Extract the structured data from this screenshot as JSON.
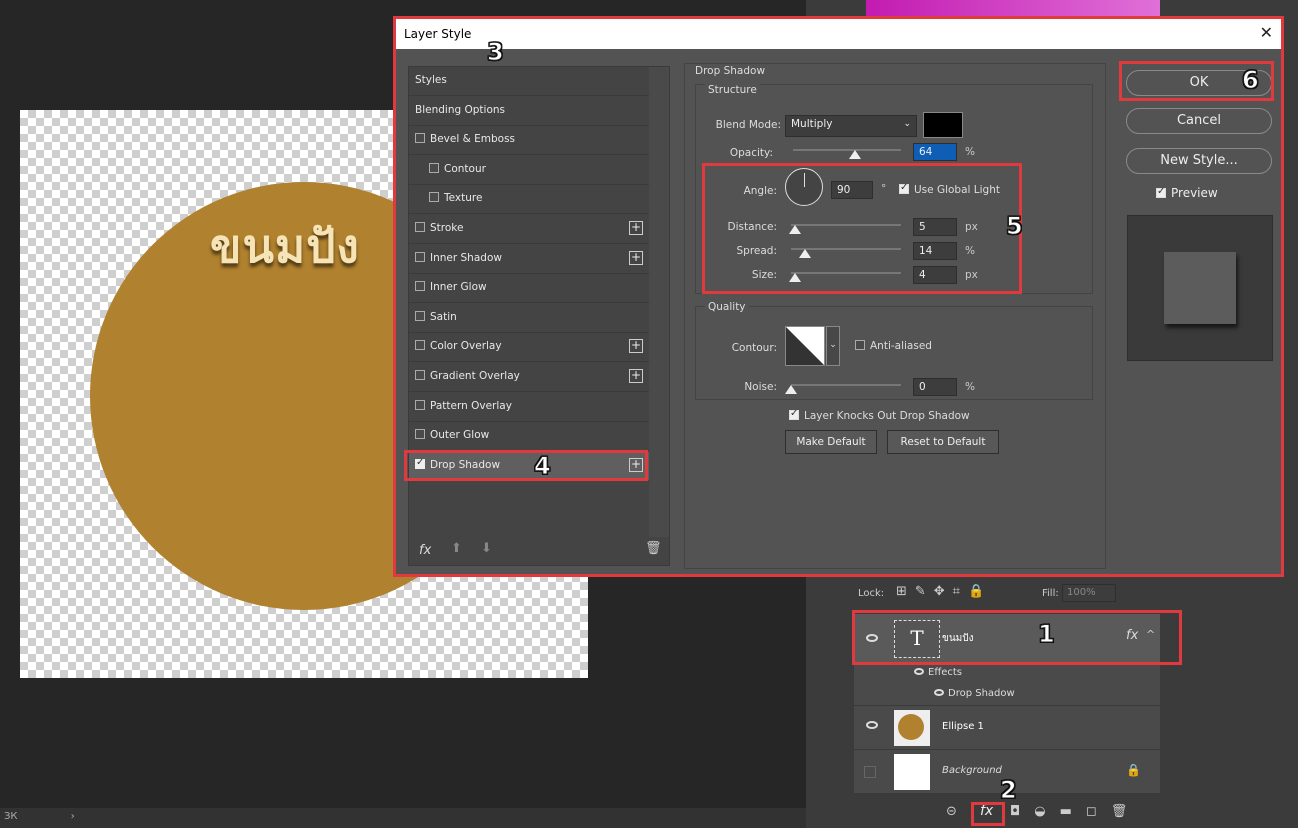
{
  "canvas": {
    "text": "ขนมปัง",
    "statusbar": "ЗК",
    "statusbar_arrow": "›"
  },
  "dialog": {
    "title": "Layer Style",
    "close": "✕",
    "styles": [
      {
        "label": "Styles",
        "has_checkbox": false,
        "checked": false,
        "has_plus": false
      },
      {
        "label": "Blending Options",
        "has_checkbox": false,
        "checked": false,
        "has_plus": false
      },
      {
        "label": "Bevel & Emboss",
        "has_checkbox": true,
        "checked": false,
        "has_plus": false
      },
      {
        "label": "Contour",
        "has_checkbox": true,
        "checked": false,
        "has_plus": false
      },
      {
        "label": "Texture",
        "has_checkbox": true,
        "checked": false,
        "has_plus": false
      },
      {
        "label": "Stroke",
        "has_checkbox": true,
        "checked": false,
        "has_plus": true
      },
      {
        "label": "Inner Shadow",
        "has_checkbox": true,
        "checked": false,
        "has_plus": true
      },
      {
        "label": "Inner Glow",
        "has_checkbox": true,
        "checked": false,
        "has_plus": false
      },
      {
        "label": "Satin",
        "has_checkbox": true,
        "checked": false,
        "has_plus": false
      },
      {
        "label": "Color Overlay",
        "has_checkbox": true,
        "checked": false,
        "has_plus": true
      },
      {
        "label": "Gradient Overlay",
        "has_checkbox": true,
        "checked": false,
        "has_plus": true
      },
      {
        "label": "Pattern Overlay",
        "has_checkbox": true,
        "checked": false,
        "has_plus": false
      },
      {
        "label": "Outer Glow",
        "has_checkbox": true,
        "checked": false,
        "has_plus": false
      },
      {
        "label": "Drop Shadow",
        "has_checkbox": true,
        "checked": true,
        "has_plus": true
      }
    ],
    "footer_icons": [
      "fx-icon",
      "arrow-up-icon",
      "arrow-down-icon",
      "trash-icon"
    ],
    "drop_shadow": {
      "section_title": "Drop Shadow",
      "structure_title": "Structure",
      "blend_mode_label": "Blend Mode:",
      "blend_mode_value": "Multiply",
      "shadow_color": "#000000",
      "opacity_label": "Opacity:",
      "opacity_value": "64",
      "opacity_unit": "%",
      "angle_label": "Angle:",
      "angle_value": "90",
      "angle_unit": "°",
      "use_global_light": "Use Global Light",
      "distance_label": "Distance:",
      "distance_value": "5",
      "distance_unit": "px",
      "spread_label": "Spread:",
      "spread_value": "14",
      "spread_unit": "%",
      "size_label": "Size:",
      "size_value": "4",
      "size_unit": "px",
      "quality_title": "Quality",
      "contour_label": "Contour:",
      "anti_aliased": "Anti-aliased",
      "noise_label": "Noise:",
      "noise_value": "0",
      "noise_unit": "%",
      "knocks_out": "Layer Knocks Out Drop Shadow",
      "make_default": "Make Default",
      "reset_default": "Reset to Default"
    },
    "buttons": {
      "ok": "OK",
      "cancel": "Cancel",
      "new_style": "New Style...",
      "preview": "Preview"
    }
  },
  "layers": {
    "lock_label": "Lock:",
    "fill_label": "Fill:",
    "fill_value": "100%",
    "items": [
      {
        "name": "ขนมปัง",
        "type": "text"
      },
      {
        "name": "Effects",
        "type": "effects"
      },
      {
        "name": "Drop Shadow",
        "type": "effect"
      },
      {
        "name": "Ellipse 1",
        "type": "shape"
      },
      {
        "name": "Background",
        "type": "background"
      }
    ],
    "fx_label": "fx"
  },
  "callouts": [
    "1",
    "2",
    "3",
    "4",
    "5",
    "6"
  ],
  "colors": {
    "annotation_red": "#e0393e",
    "ellipse": "#b0812e",
    "text_fill": "#f6e3b6"
  }
}
